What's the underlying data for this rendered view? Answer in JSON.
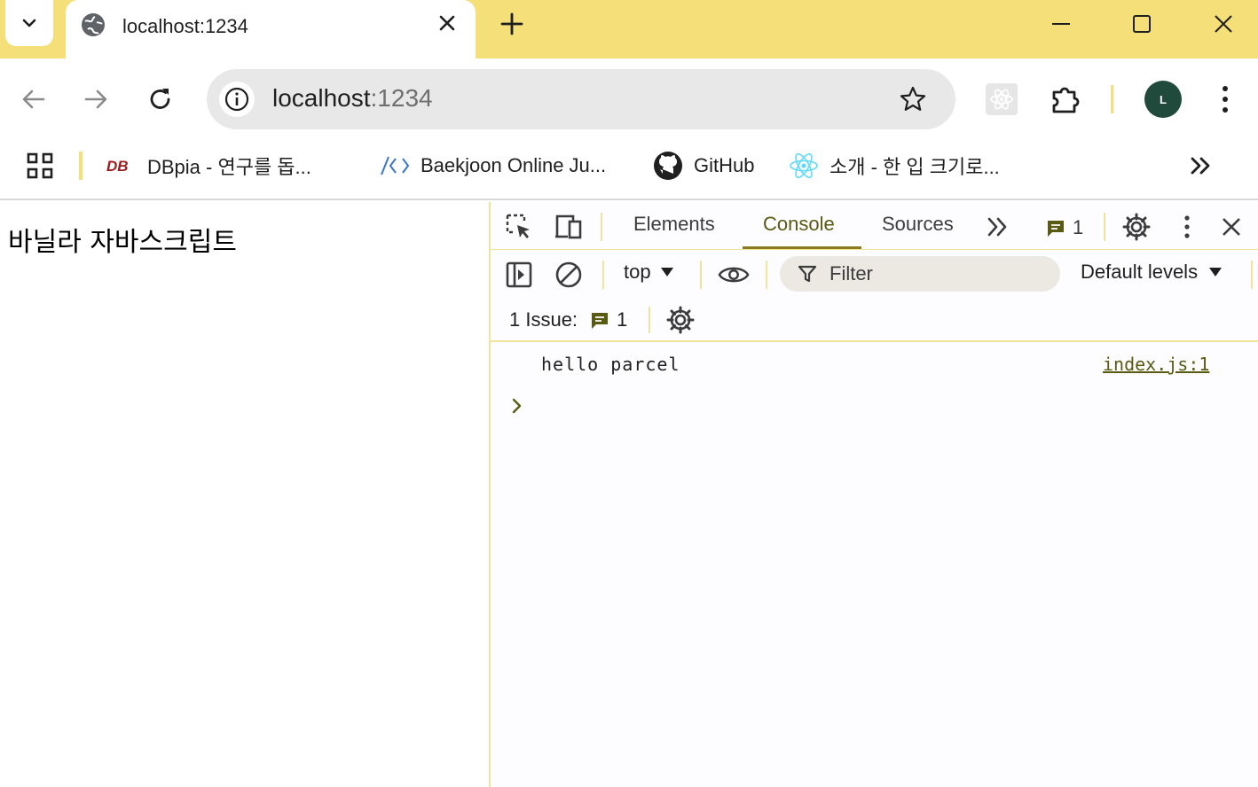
{
  "browser": {
    "tab": {
      "title": "localhost:1234"
    },
    "address": {
      "host": "localhost",
      "port": ":1234"
    },
    "avatar_letter": "L",
    "bookmarks": [
      {
        "label": "DBpia - 연구를 돕...",
        "icon": "dbpia-icon"
      },
      {
        "label": "Baekjoon Online Ju...",
        "icon": "code-brackets-icon"
      },
      {
        "label": "GitHub",
        "icon": "github-icon"
      },
      {
        "label": "소개 - 한 입 크기로...",
        "icon": "react-icon"
      }
    ]
  },
  "page": {
    "heading": "바닐라 자바스크립트"
  },
  "devtools": {
    "tabs": [
      "Elements",
      "Console",
      "Sources"
    ],
    "active_tab": "Console",
    "issues_badge": "1",
    "context": "top",
    "filter_placeholder": "Filter",
    "levels": "Default levels",
    "issue_bar": {
      "label": "1 Issue:",
      "count": "1"
    },
    "console": [
      {
        "message": "hello parcel",
        "source": "index.js:1"
      }
    ]
  },
  "colors": {
    "frame": "#f4df78",
    "accent_text": "#5a5b13",
    "devtools_border": "#efe49a"
  }
}
